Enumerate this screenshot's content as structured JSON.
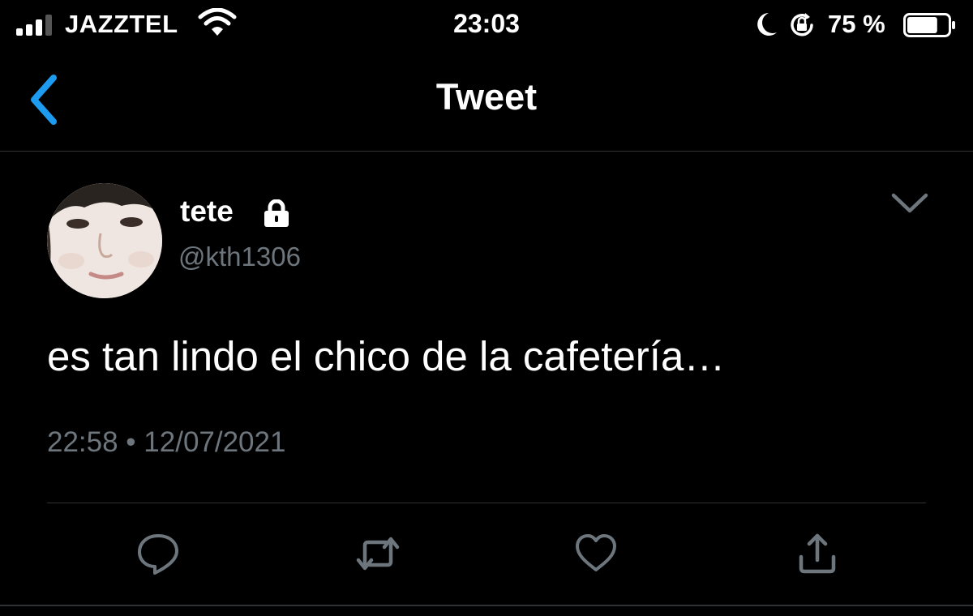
{
  "status_bar": {
    "carrier": "JAZZTEL",
    "time": "23:03",
    "battery_percent": "75 %",
    "battery_level": 0.75,
    "icons": [
      "signal-icon",
      "wifi-icon",
      "moon-icon",
      "rotation-lock-icon",
      "battery-icon"
    ]
  },
  "nav": {
    "title": "Tweet",
    "back_icon": "chevron-left-icon"
  },
  "tweet": {
    "display_name": "tete",
    "handle": "@kth1306",
    "protected_icon": "lock-icon",
    "text": "es tan lindo el chico de la cafetería…",
    "time": "22:58",
    "separator": "•",
    "date": "12/07/2021",
    "meta": "22:58 • 12/07/2021",
    "menu_icon": "chevron-down-icon"
  },
  "actions": [
    {
      "name": "reply",
      "icon": "reply-icon"
    },
    {
      "name": "retweet",
      "icon": "retweet-icon"
    },
    {
      "name": "like",
      "icon": "heart-icon"
    },
    {
      "name": "share",
      "icon": "share-icon"
    }
  ],
  "colors": {
    "background": "#000000",
    "text_primary": "#ffffff",
    "text_secondary": "#6e767d",
    "accent": "#1d9bf0",
    "divider": "#2f3336"
  }
}
